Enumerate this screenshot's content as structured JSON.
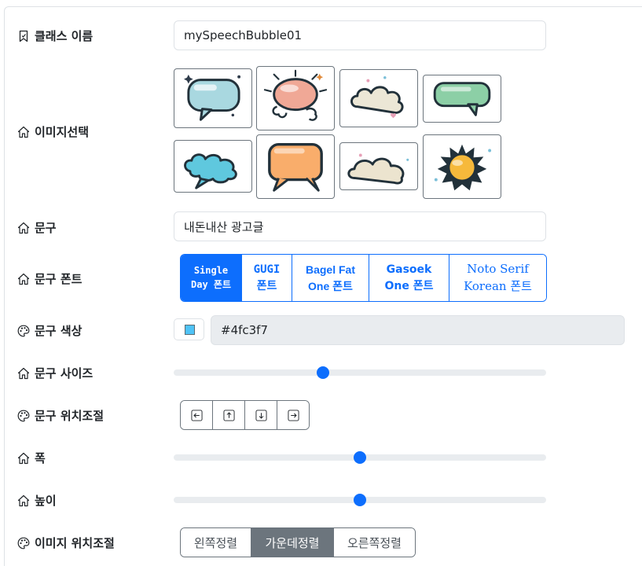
{
  "form": {
    "class_name": {
      "label": "클래스 이름",
      "value": "mySpeechBubble01",
      "icon": "bookmark-icon"
    },
    "image_select": {
      "label": "이미지선택",
      "icon": "house-icon",
      "images": [
        {
          "name": "bubble-blue-rounded",
          "color": "#a9d8e0"
        },
        {
          "name": "bubble-pink-burst",
          "color": "#f0a896"
        },
        {
          "name": "bubble-cream-cloud",
          "color": "#ece7d6"
        },
        {
          "name": "bubble-green-rect",
          "color": "#8ccfa6"
        },
        {
          "name": "bubble-cyan-cloud",
          "color": "#5fc8de"
        },
        {
          "name": "bubble-orange-rect",
          "color": "#f9ad6b"
        },
        {
          "name": "bubble-beige-cloud",
          "color": "#ece4cf"
        },
        {
          "name": "bubble-yellow-burst",
          "color": "#f6b93b"
        }
      ]
    },
    "phrase": {
      "label": "문구",
      "value": "내돈내산 광고글",
      "icon": "house-icon"
    },
    "phrase_font": {
      "label": "문구 폰트",
      "icon": "house-icon",
      "options": [
        {
          "line1": "Single",
          "line2": "Day 폰트",
          "active": true
        },
        {
          "line1": "GUGI",
          "line2": "폰트",
          "active": false
        },
        {
          "line1": "Bagel Fat",
          "line2": "One 폰트",
          "active": false
        },
        {
          "line1": "Gasoek",
          "line2": "One 폰트",
          "active": false
        },
        {
          "line1": "Noto Serif",
          "line2": "Korean 폰트",
          "active": false
        }
      ]
    },
    "phrase_color": {
      "label": "문구 색상",
      "value": "#4fc3f7",
      "swatch": "#4fc3f7",
      "icon": "palette-icon"
    },
    "phrase_size": {
      "label": "문구 사이즈",
      "icon": "house-icon",
      "level": 0.4
    },
    "phrase_position": {
      "label": "문구 위치조절",
      "icon": "palette-icon",
      "buttons": [
        "arrow-left-icon",
        "arrow-up-icon",
        "arrow-down-icon",
        "arrow-right-icon"
      ]
    },
    "width": {
      "label": "폭",
      "icon": "house-icon",
      "level": 0.5
    },
    "height": {
      "label": "높이",
      "icon": "house-icon",
      "level": 0.5
    },
    "image_position": {
      "label": "이미지 위치조절",
      "icon": "palette-icon",
      "options": [
        {
          "label": "왼쪽정렬",
          "active": false
        },
        {
          "label": "가운데정렬",
          "active": true
        },
        {
          "label": "오른쪽정렬",
          "active": false
        }
      ]
    }
  },
  "colors": {
    "primary": "#0d6efd",
    "secondary": "#6c757d",
    "input_border": "#dee2e6",
    "disabled_bg": "#e9ecef"
  }
}
